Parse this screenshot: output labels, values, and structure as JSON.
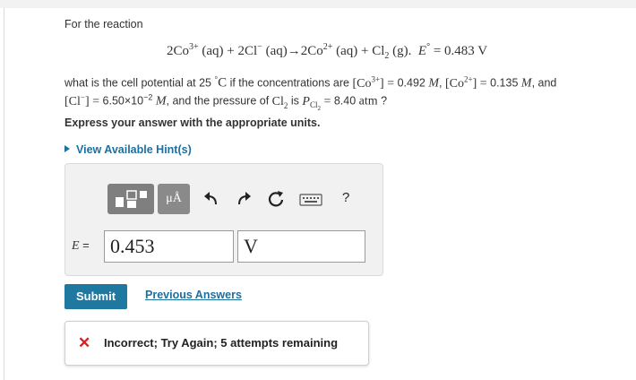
{
  "question": {
    "intro": "For the reaction",
    "equation": {
      "coef1": "2Co",
      "sup1": "3+",
      "aq1": " (aq) + 2Cl",
      "sup2": "−",
      "aq2": " (aq)→2Co",
      "sup3": "2+",
      "aq3": " (aq) + Cl",
      "sub1": "2",
      "gas": " (g).",
      "e_label": "E",
      "e_sup": "°",
      "e_value": " = 0.483 V"
    },
    "line1": {
      "a": "what is the cell potential at 25 ",
      "deg": "°",
      "c": "C",
      "b": " if the concentrations are ",
      "co3": "[Co",
      "co3_sup": "3+",
      "co3_end": "] = ",
      "co3_val": "0.492 ",
      "M1": "M",
      "sep1": ", ",
      "co2": "[Co",
      "co2_sup": "2+",
      "co2_end": "] = ",
      "co2_val": "0.135 ",
      "M2": "M",
      "and": ", and"
    },
    "line2": {
      "cl": "[Cl",
      "cl_sup": "−",
      "cl_end": "] = ",
      "cl_val": "6.50×10",
      "cl_exp": "−2",
      "M3": " M",
      "mid": ", and the pressure of ",
      "gas": "Cl",
      "gas_sub": "2",
      "is": " is ",
      "p": "P",
      "p_sub": "Cl",
      "p_sub2": "2",
      "eq": " = ",
      "p_val": "8.40 ",
      "atm": "atm",
      "q": " ?"
    },
    "instruction": "Express your answer with the appropriate units."
  },
  "hint_link": "View Available Hint(s)",
  "toolbar": {
    "mu_label": "μÅ",
    "help": "?",
    "icons": [
      "templates-icon",
      "units-icon",
      "undo-icon",
      "redo-icon",
      "reset-icon",
      "keyboard-icon",
      "help-icon"
    ]
  },
  "answer": {
    "label": "E =",
    "value": "0.453",
    "unit": "V"
  },
  "submit_label": "Submit",
  "previous_answers": "Previous Answers",
  "feedback": {
    "icon": "✕",
    "message": "Incorrect; Try Again; 5 attempts remaining"
  },
  "colors": {
    "link": "#1d6f9f",
    "submit_bg": "#1e78a0",
    "error": "#d72020"
  }
}
